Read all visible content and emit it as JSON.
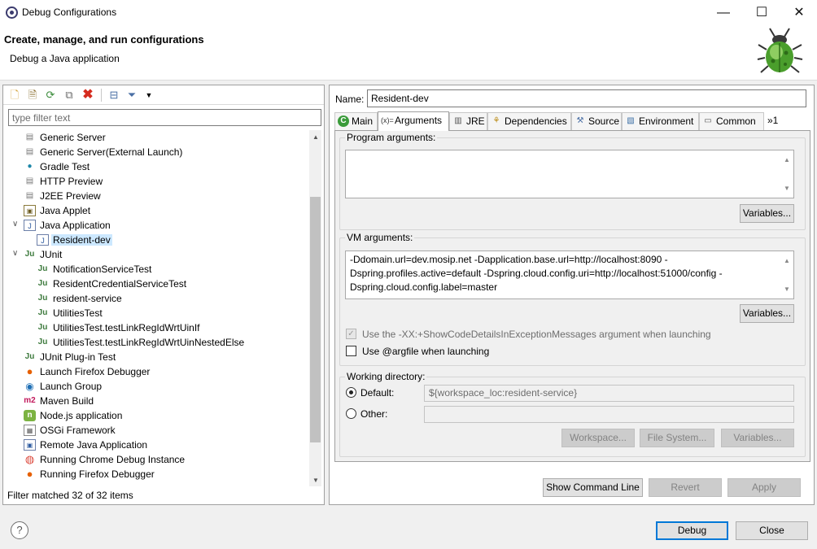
{
  "window": {
    "title": "Debug Configurations",
    "minimize": "—",
    "maximize": "☐",
    "close": "✕"
  },
  "header": {
    "title": "Create, manage, and run configurations",
    "subtitle": "Debug a Java application"
  },
  "filter": {
    "placeholder": "type filter text",
    "status": "Filter matched 32 of 32 items"
  },
  "tree": [
    {
      "label": "Generic Server",
      "icon": "server-icon"
    },
    {
      "label": "Generic Server(External Launch)",
      "icon": "server-icon"
    },
    {
      "label": "Gradle Test",
      "icon": "gradle-elephant-icon"
    },
    {
      "label": "HTTP Preview",
      "icon": "server-icon"
    },
    {
      "label": "J2EE Preview",
      "icon": "server-icon"
    },
    {
      "label": "Java Applet",
      "icon": "applet-icon"
    },
    {
      "label": "Java Application",
      "icon": "java-app-icon"
    },
    {
      "label": "Resident-dev",
      "icon": "java-app-icon"
    },
    {
      "label": "JUnit",
      "icon": "junit-icon"
    },
    {
      "label": "NotificationServiceTest",
      "icon": "junit-icon"
    },
    {
      "label": "ResidentCredentialServiceTest",
      "icon": "junit-icon"
    },
    {
      "label": "resident-service",
      "icon": "junit-icon"
    },
    {
      "label": "UtilitiesTest",
      "icon": "junit-icon"
    },
    {
      "label": "UtilitiesTest.testLinkRegIdWrtUinIf",
      "icon": "junit-icon"
    },
    {
      "label": "UtilitiesTest.testLinkRegIdWrtUinNestedElse",
      "icon": "junit-icon"
    },
    {
      "label": "JUnit Plug-in Test",
      "icon": "junit-plugin-icon"
    },
    {
      "label": "Launch Firefox Debugger",
      "icon": "firefox-icon"
    },
    {
      "label": "Launch Group",
      "icon": "launch-group-icon"
    },
    {
      "label": "Maven Build",
      "icon": "maven-icon"
    },
    {
      "label": "Node.js application",
      "icon": "nodejs-icon"
    },
    {
      "label": "OSGi Framework",
      "icon": "osgi-icon"
    },
    {
      "label": "Remote Java Application",
      "icon": "remote-java-icon"
    },
    {
      "label": "Running Chrome Debug Instance",
      "icon": "chrome-icon"
    },
    {
      "label": "Running Firefox Debugger",
      "icon": "firefox-icon"
    }
  ],
  "config": {
    "name_label": "Name:",
    "name_value": "Resident-dev",
    "tabs": [
      {
        "label": "Main",
        "icon": "main-tab-icon"
      },
      {
        "label": "Arguments",
        "icon": "arguments-tab-icon"
      },
      {
        "label": "JRE",
        "icon": "jre-tab-icon"
      },
      {
        "label": "Dependencies",
        "icon": "dependencies-tab-icon"
      },
      {
        "label": "Source",
        "icon": "source-tab-icon"
      },
      {
        "label": "Environment",
        "icon": "environment-tab-icon"
      },
      {
        "label": "Common",
        "icon": "common-tab-icon"
      },
      {
        "label": "»1",
        "icon": ""
      }
    ],
    "program_args_label": "Program arguments:",
    "program_args_value": "",
    "variables_label": "Variables...",
    "vm_args_label": "VM arguments:",
    "vm_args_value": "-Ddomain.url=dev.mosip.net -Dapplication.base.url=http://localhost:8090 -Dspring.profiles.active=default -Dspring.cloud.config.uri=http://localhost:51000/config -Dspring.cloud.config.label=master",
    "show_code_details_label": "Use the -XX:+ShowCodeDetailsInExceptionMessages argument when launching",
    "argfile_label": "Use @argfile when launching",
    "working_dir_label": "Working directory:",
    "default_label": "Default:",
    "default_value": "${workspace_loc:resident-service}",
    "other_label": "Other:",
    "other_value": "",
    "workspace_label": "Workspace...",
    "filesystem_label": "File System...",
    "variables2_label": "Variables..."
  },
  "buttons": {
    "show_command_line": "Show Command Line",
    "revert": "Revert",
    "apply": "Apply",
    "debug": "Debug",
    "close": "Close"
  }
}
